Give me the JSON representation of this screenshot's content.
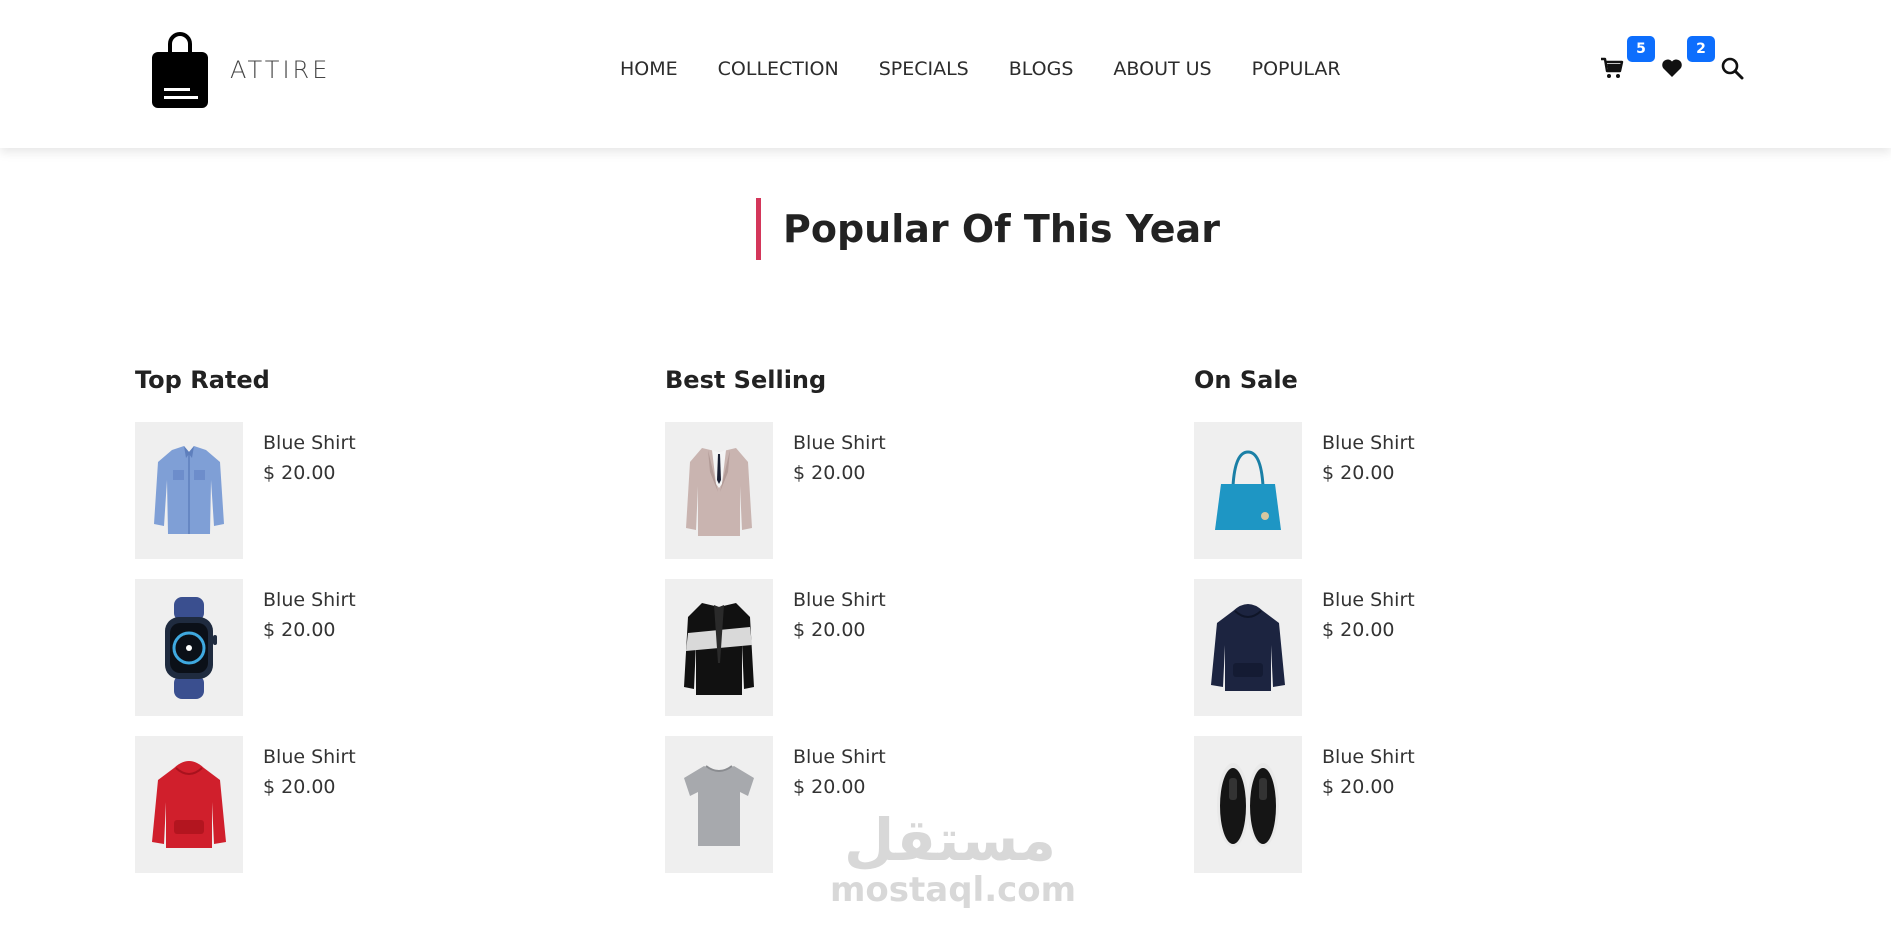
{
  "header": {
    "brand": "ATTIRE",
    "nav": [
      "HOME",
      "COLLECTION",
      "SPECIALS",
      "BLOGS",
      "ABOUT US",
      "POPULAR"
    ],
    "cart_count": "5",
    "wishlist_count": "2",
    "badge_color": "#0d6efd",
    "icons": [
      "shopping-bag-icon",
      "cart-icon",
      "heart-icon",
      "search-icon"
    ]
  },
  "section": {
    "title": "Popular Of This Year",
    "accent_color": "#d4365a"
  },
  "columns": [
    {
      "title": "Top Rated",
      "products": [
        {
          "name": "Blue Shirt",
          "price": "$ 20.00",
          "image": "blue-shirt-image"
        },
        {
          "name": "Blue Shirt",
          "price": "$ 20.00",
          "image": "smartwatch-image"
        },
        {
          "name": "Blue Shirt",
          "price": "$ 20.00",
          "image": "red-hoodie-image"
        }
      ]
    },
    {
      "title": "Best Selling",
      "products": [
        {
          "name": "Blue Shirt",
          "price": "$ 20.00",
          "image": "beige-suit-image"
        },
        {
          "name": "Blue Shirt",
          "price": "$ 20.00",
          "image": "black-blazer-image"
        },
        {
          "name": "Blue Shirt",
          "price": "$ 20.00",
          "image": "grey-tshirt-image"
        }
      ]
    },
    {
      "title": "On Sale",
      "products": [
        {
          "name": "Blue Shirt",
          "price": "$ 20.00",
          "image": "blue-handbag-image"
        },
        {
          "name": "Blue Shirt",
          "price": "$ 20.00",
          "image": "navy-hoodie-image"
        },
        {
          "name": "Blue Shirt",
          "price": "$ 20.00",
          "image": "black-sneakers-image"
        }
      ]
    }
  ],
  "watermark": {
    "arabic": "مستقل",
    "latin": "mostaql.com"
  }
}
